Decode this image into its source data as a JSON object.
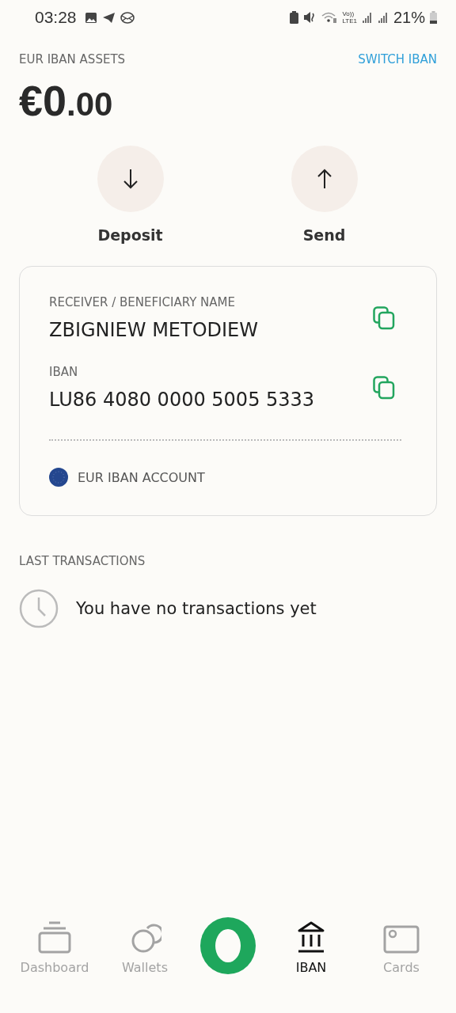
{
  "status_bar": {
    "time": "03:28",
    "volte": "Vo))",
    "network": "LTE1",
    "battery": "21%"
  },
  "header": {
    "title": "EUR IBAN ASSETS",
    "link": "SWITCH IBAN"
  },
  "balance": {
    "whole": "€0",
    "fraction": ".00"
  },
  "actions": [
    {
      "kind": "deposit",
      "label": "Deposit"
    },
    {
      "kind": "send",
      "label": "Send"
    }
  ],
  "account_card": {
    "fields": [
      {
        "label": "RECEIVER / BENEFICIARY NAME",
        "value": "ZBIGNIEW METODIEW"
      },
      {
        "label": "IBAN",
        "value": "LU86 4080 0000 5005 5333"
      }
    ],
    "account_type": "EUR IBAN ACCOUNT"
  },
  "transactions": {
    "title": "LAST TRANSACTIONS",
    "empty_message": "You have no transactions yet"
  },
  "bottom_nav": [
    {
      "kind": "dashboard",
      "label": "Dashboard",
      "selected": false
    },
    {
      "kind": "wallets",
      "label": "Wallets",
      "selected": false
    },
    {
      "kind": "logo"
    },
    {
      "kind": "iban",
      "label": "IBAN",
      "selected": true
    },
    {
      "kind": "cards",
      "label": "Cards",
      "selected": false
    }
  ]
}
